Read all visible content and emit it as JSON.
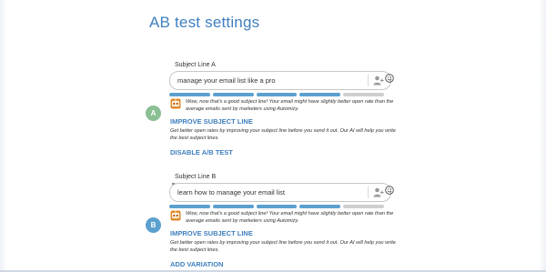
{
  "page": {
    "title": "AB test settings"
  },
  "variant_a": {
    "badge": "A",
    "label": "Subject Line A",
    "value": "manage your email list like a pro",
    "placeholder": "",
    "meter": {
      "segments": 5,
      "filled": 4
    },
    "feedback": "Wow, now that's a good subject line! Your email might have slightly better open rate than the average emails sent by marketers using Automizy.",
    "improve_label": "IMPROVE SUBJECT LINE",
    "help_text": "Get better open rates by improving your subject line before you send it out. Our AI will help you write the best subject lines.",
    "action_label": "DISABLE A/B TEST"
  },
  "variant_b": {
    "badge": "B",
    "label": "Subject Line B",
    "value": "learn how to manage your email list",
    "placeholder": "",
    "meter": {
      "segments": 5,
      "filled": 4
    },
    "feedback": "Wow, now that's a good subject line! Your email might have slightly better open rate than the average emails sent by marketers using Automizy.",
    "improve_label": "IMPROVE SUBJECT LINE",
    "help_text": "Get better open rates by improving your subject line before you send it out. Our AI will help you write the best subject lines.",
    "action_label": "ADD VARIATION"
  },
  "icons": {
    "personalize": "person-plus-icon",
    "emoji": "smiley-icon",
    "assistant": "robot-icon"
  },
  "colors": {
    "accent": "#3f7fbf",
    "meter_on": "#5ba0cf",
    "meter_off": "#cfcfcf",
    "badge_a": "#8bbf94",
    "badge_b": "#5ba0cf"
  }
}
